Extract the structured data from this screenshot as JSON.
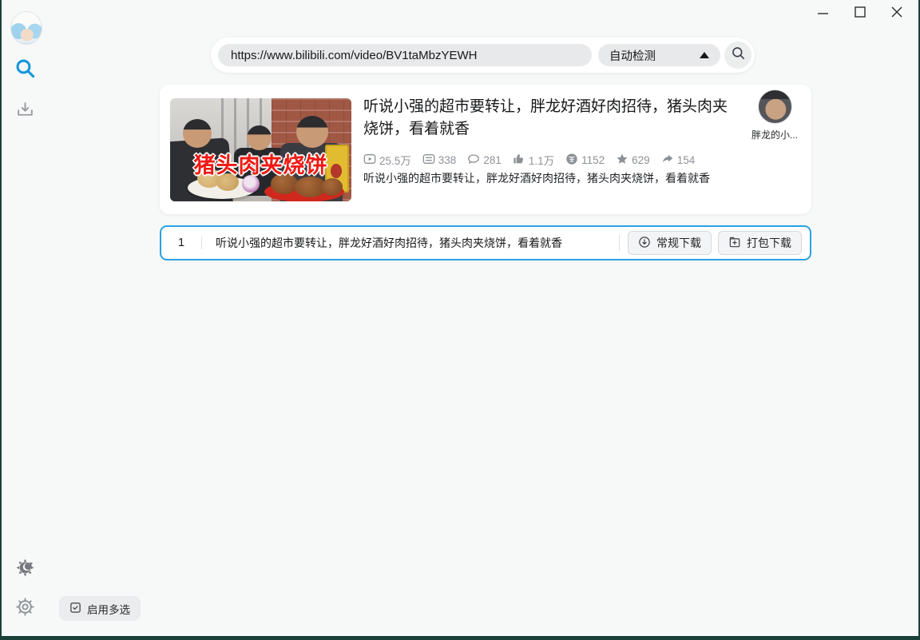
{
  "window": {
    "edge_color": "#1a423a",
    "background": "#f7f8f8"
  },
  "search_bar": {
    "url": "https://www.bilibili.com/video/BV1taMbzYEWH",
    "mode_selector_label": "自动检测"
  },
  "video_card": {
    "title": "听说小强的超市要转让，胖龙好酒好肉招待，猪头肉夹烧饼，看着就香",
    "thumbnail_caption": "猪头肉夹烧饼",
    "stats": {
      "plays": "25.5万",
      "danmaku": "338",
      "comments": "281",
      "likes": "1.1万",
      "coins": "1152",
      "favorites": "629",
      "shares": "154"
    },
    "description": "听说小强的超市要转让，胖龙好酒好肉招待，猪头肉夹烧饼，看着就香",
    "uploader_name": "胖龙的小..."
  },
  "download_row": {
    "index": "1",
    "title": "听说小强的超市要转让，胖龙好酒好肉招待，猪头肉夹烧饼，看着就香",
    "regular_download_label": "常规下载",
    "package_download_label": "打包下载"
  },
  "footer": {
    "multi_select_label": "启用多选"
  },
  "icons": {
    "sidebar": [
      "search-icon",
      "download-icon",
      "theme-toggle-icon",
      "settings-gear-icon"
    ],
    "stats": [
      "play-icon",
      "danmaku-icon",
      "comment-icon",
      "like-icon",
      "coin-icon",
      "star-icon",
      "share-icon"
    ],
    "colors": {
      "accent_blue": "#29a3e3",
      "search_blue": "#1296db",
      "icon_gray": "#8d9196",
      "caption_red": "#ee1a14"
    }
  }
}
